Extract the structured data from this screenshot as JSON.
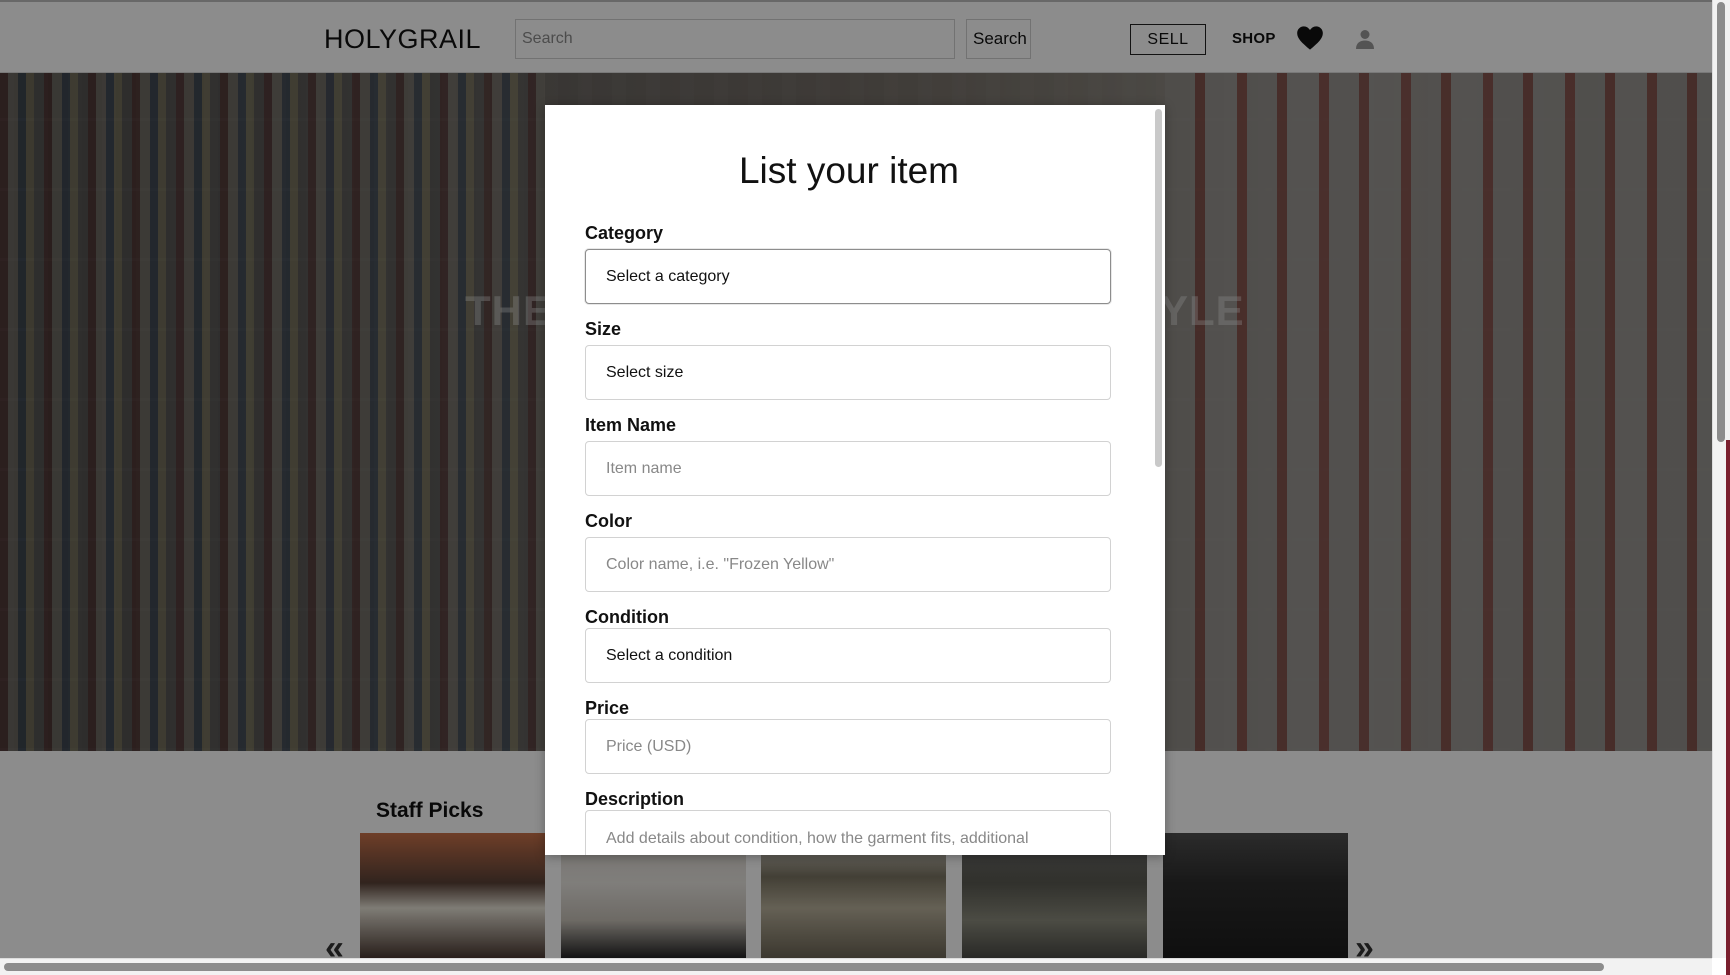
{
  "header": {
    "logo": "HOLYGRAIL",
    "search_placeholder": "Search",
    "search_button": "Search",
    "sell_button": "SELL",
    "shop_link": "SHOP",
    "icons": [
      "heart-icon",
      "user-icon"
    ]
  },
  "hero": {
    "text_left": "THE",
    "text_right": "YLE"
  },
  "staff_picks": {
    "title": "Staff Picks",
    "prev": "«",
    "next": "»"
  },
  "modal": {
    "title": "List your item",
    "fields": {
      "category": {
        "label": "Category",
        "value": "Select a category"
      },
      "size": {
        "label": "Size",
        "value": "Select size"
      },
      "item_name": {
        "label": "Item Name",
        "placeholder": "Item name"
      },
      "color": {
        "label": "Color",
        "placeholder": "Color name, i.e. \"Frozen Yellow\""
      },
      "condition": {
        "label": "Condition",
        "value": "Select a condition"
      },
      "price": {
        "label": "Price",
        "placeholder": "Price (USD)"
      },
      "description": {
        "label": "Description",
        "placeholder": "Add details about condition, how the garment fits, additional"
      }
    }
  },
  "colors": {
    "overlay": "#000000",
    "modal_bg": "#ffffff",
    "text": "#111111"
  }
}
